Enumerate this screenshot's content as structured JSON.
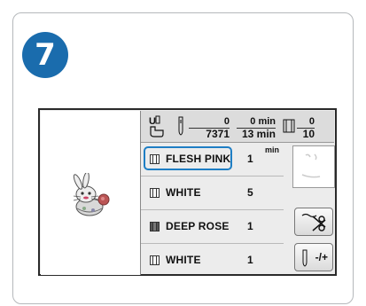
{
  "step": {
    "number": "7"
  },
  "info_bar": {
    "stitch_current": "0",
    "stitch_total": "7371",
    "time_current": "0 min",
    "time_total": "13 min",
    "color_current": "0",
    "color_total": "10"
  },
  "thread_list": {
    "min_label": "min",
    "rows": [
      {
        "name": "FLESH PINK",
        "count": "1",
        "selected": true,
        "swatch": "#f6d6c6"
      },
      {
        "name": "WHITE",
        "count": "5",
        "selected": false,
        "swatch": "#ffffff"
      },
      {
        "name": "DEEP ROSE",
        "count": "1",
        "selected": false,
        "swatch": "#666666"
      },
      {
        "name": "WHITE",
        "count": "1",
        "selected": false,
        "swatch": "#ffffff"
      }
    ]
  },
  "buttons": {
    "tension_label": "-/+"
  },
  "colors": {
    "step_badge": "#1a6cad",
    "selected_outline": "#1e7ec4"
  }
}
